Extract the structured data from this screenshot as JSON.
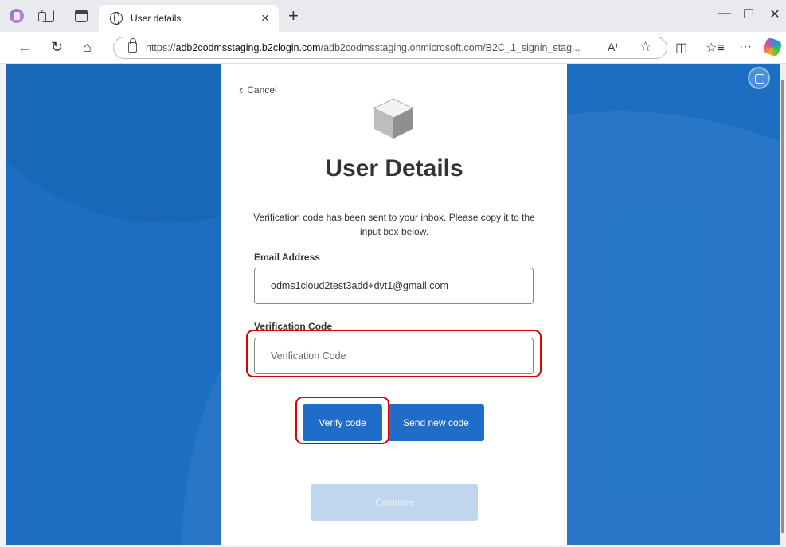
{
  "browser": {
    "tab_title": "User details",
    "tab_close": "×",
    "new_tab": "+",
    "url_prefix": "https://",
    "url_host": "adb2codmsstaging.b2clogin.com",
    "url_path": "/adb2codmsstaging.onmicrosoft.com/B2C_1_signin_stag...",
    "read_aloud": "A⁾",
    "favorite": "☆",
    "more": "···",
    "minimize": "—",
    "maximize": "☐",
    "close": "✕",
    "back": "←",
    "reload": "↻",
    "home": "⌂",
    "split": "◫",
    "favorites": "☆≡"
  },
  "page": {
    "background_color": "#1b6ec2",
    "cancel_label": "Cancel",
    "title": "User Details",
    "info_text": "Verification code has been sent to your inbox. Please copy it to the input box below.",
    "email_label": "Email Address",
    "email_value": "odms1cloud2test3add+dvt1@gmail.com",
    "code_label": "Verification Code",
    "code_placeholder": "Verification Code",
    "verify_button": "Verify code",
    "send_button": "Send new code",
    "continue_button": "Continue",
    "button_color": "#1f6dc8",
    "highlight_color": "#d80000"
  }
}
